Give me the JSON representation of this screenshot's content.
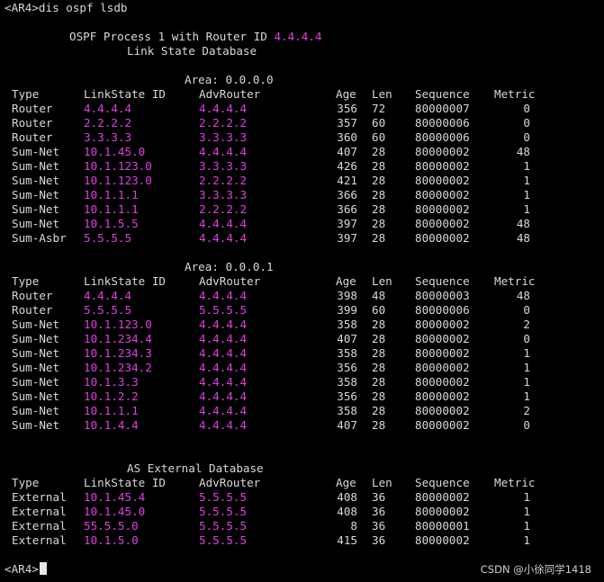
{
  "prompt": "<AR4>",
  "command": "dis ospf lsdb",
  "process_line": "OSPF Process 1 with Router ID ",
  "router_id": "4.4.4.4",
  "db_title": "Link State Database",
  "headers": {
    "type": "Type",
    "lsid": "LinkState ID",
    "adv": "AdvRouter",
    "age": "Age",
    "len": "Len",
    "seq": "Sequence",
    "metric": "Metric"
  },
  "areas": [
    {
      "title": "Area: 0.0.0.0",
      "rows": [
        [
          "Router",
          "4.4.4.4",
          "4.4.4.4",
          "356",
          "72",
          "80000007",
          "0"
        ],
        [
          "Router",
          "2.2.2.2",
          "2.2.2.2",
          "357",
          "60",
          "80000006",
          "0"
        ],
        [
          "Router",
          "3.3.3.3",
          "3.3.3.3",
          "360",
          "60",
          "80000006",
          "0"
        ],
        [
          "Sum-Net",
          "10.1.45.0",
          "4.4.4.4",
          "407",
          "28",
          "80000002",
          "48"
        ],
        [
          "Sum-Net",
          "10.1.123.0",
          "3.3.3.3",
          "426",
          "28",
          "80000002",
          "1"
        ],
        [
          "Sum-Net",
          "10.1.123.0",
          "2.2.2.2",
          "421",
          "28",
          "80000002",
          "1"
        ],
        [
          "Sum-Net",
          "10.1.1.1",
          "3.3.3.3",
          "366",
          "28",
          "80000002",
          "1"
        ],
        [
          "Sum-Net",
          "10.1.1.1",
          "2.2.2.2",
          "366",
          "28",
          "80000002",
          "1"
        ],
        [
          "Sum-Net",
          "10.1.5.5",
          "4.4.4.4",
          "397",
          "28",
          "80000002",
          "48"
        ],
        [
          "Sum-Asbr",
          "5.5.5.5",
          "4.4.4.4",
          "397",
          "28",
          "80000002",
          "48"
        ]
      ]
    },
    {
      "title": "Area: 0.0.0.1",
      "rows": [
        [
          "Router",
          "4.4.4.4",
          "4.4.4.4",
          "398",
          "48",
          "80000003",
          "48"
        ],
        [
          "Router",
          "5.5.5.5",
          "5.5.5.5",
          "399",
          "60",
          "80000006",
          "0"
        ],
        [
          "Sum-Net",
          "10.1.123.0",
          "4.4.4.4",
          "358",
          "28",
          "80000002",
          "2"
        ],
        [
          "Sum-Net",
          "10.1.234.4",
          "4.4.4.4",
          "407",
          "28",
          "80000002",
          "0"
        ],
        [
          "Sum-Net",
          "10.1.234.3",
          "4.4.4.4",
          "358",
          "28",
          "80000002",
          "1"
        ],
        [
          "Sum-Net",
          "10.1.234.2",
          "4.4.4.4",
          "356",
          "28",
          "80000002",
          "1"
        ],
        [
          "Sum-Net",
          "10.1.3.3",
          "4.4.4.4",
          "358",
          "28",
          "80000002",
          "1"
        ],
        [
          "Sum-Net",
          "10.1.2.2",
          "4.4.4.4",
          "356",
          "28",
          "80000002",
          "1"
        ],
        [
          "Sum-Net",
          "10.1.1.1",
          "4.4.4.4",
          "358",
          "28",
          "80000002",
          "2"
        ],
        [
          "Sum-Net",
          "10.1.4.4",
          "4.4.4.4",
          "407",
          "28",
          "80000002",
          "0"
        ]
      ]
    },
    {
      "title": "AS External Database",
      "rows": [
        [
          "External",
          "10.1.45.4",
          "5.5.5.5",
          "408",
          "36",
          "80000002",
          "1"
        ],
        [
          "External",
          "10.1.45.0",
          "5.5.5.5",
          "408",
          "36",
          "80000002",
          "1"
        ],
        [
          "External",
          "55.5.5.0",
          "5.5.5.5",
          "8",
          "36",
          "80000001",
          "1"
        ],
        [
          "External",
          "10.1.5.0",
          "5.5.5.5",
          "415",
          "36",
          "80000002",
          "1"
        ]
      ]
    }
  ],
  "final_prompt": "<AR4>",
  "watermark": "CSDN @小徐同学1418",
  "colors": {
    "background": "#000000",
    "text": "#d9d9d9",
    "highlight": "#e040e0"
  }
}
